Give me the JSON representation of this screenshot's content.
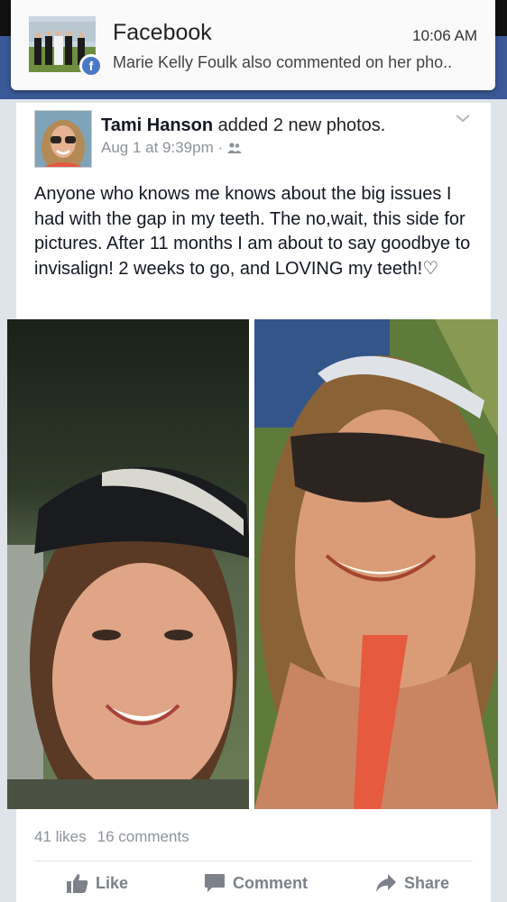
{
  "notification": {
    "app_name": "Facebook",
    "time": "10:06 AM",
    "message": "Marie Kelly Foulk also commented on her pho..",
    "badge_icon": "facebook-icon"
  },
  "post": {
    "author": "Tami Hanson",
    "action": " added 2 new photos.",
    "timestamp": "Aug 1 at 9:39pm",
    "separator": " · ",
    "privacy_icon": "friends-icon",
    "body": "Anyone who knows me knows about the big issues I had with the gap in my teeth. The no,wait, this side for pictures. After 11 months I am about to say goodbye to invisalign! 2 weeks to go, and LOVING my teeth!♡",
    "likes": "41 likes",
    "comments": "16 comments"
  },
  "actions": {
    "like": "Like",
    "comment": "Comment",
    "share": "Share"
  },
  "colors": {
    "facebook_blue": "#3b5998",
    "background": "#dfe3ea"
  }
}
